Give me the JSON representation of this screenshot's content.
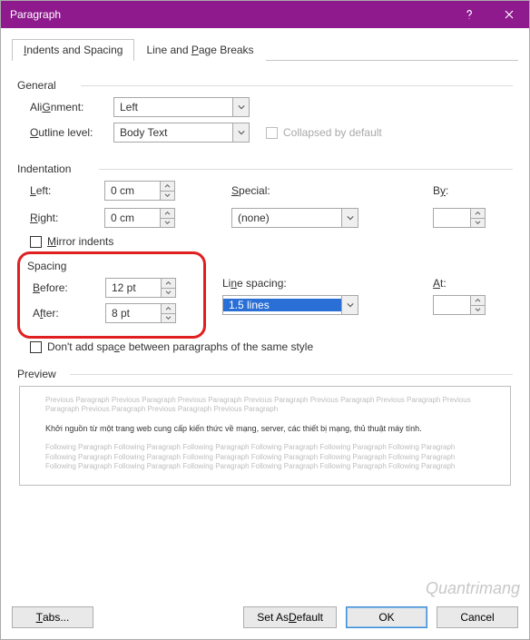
{
  "title": "Paragraph",
  "tabs": {
    "t1": "ndents and Spacing",
    "t2": "ine and ",
    "t2b": "age Breaks"
  },
  "general": {
    "label": "General",
    "alignment_lbl": "Alignment:",
    "alignment_u": "G",
    "alignment_val": "Left",
    "outline_lbl": "utline level:",
    "outline_u": "O",
    "outline_val": "Body Text",
    "collapsed_lbl": "Collapsed by default"
  },
  "indent": {
    "label": "Indentation",
    "left_u": "L",
    "left_lbl": "eft:",
    "left_val": "0 cm",
    "right_u": "R",
    "right_lbl": "ight:",
    "right_val": "0 cm",
    "special_u": "S",
    "special_lbl": "pecial:",
    "special_val": "(none)",
    "by_u": "y",
    "by_lbl": "B",
    "by_val": "",
    "mirror_u": "M",
    "mirror_lbl": "irror indents"
  },
  "spacing": {
    "label": "Spacing",
    "before_u": "B",
    "before_lbl": "efore:",
    "before_val": "12 pt",
    "after_u": "f",
    "after_lbl_a": "A",
    "after_lbl_b": "ter:",
    "after_val": "8 pt",
    "line_u": "N",
    "line_lbl": "Li",
    "line_lbl2": "e spacing:",
    "line_val": "1.5 lines",
    "at_u": "A",
    "at_lbl": "t:",
    "at_val": "",
    "dont_lbl": "Don't add spa",
    "dont_u": "c",
    "dont_lbl2": "e between paragraphs of the same style"
  },
  "preview": {
    "label": "Preview",
    "prev": "Previous Paragraph Previous Paragraph Previous Paragraph Previous Paragraph Previous Paragraph Previous Paragraph Previous Paragraph Previous Paragraph Previous Paragraph Previous Paragraph",
    "sample": "Khởi nguồn từ một trang web cung cấp kiến thức về mạng, server, các thiết bị mạng, thủ thuật máy tính.",
    "foll": "Following Paragraph Following Paragraph Following Paragraph Following Paragraph Following Paragraph Following Paragraph Following Paragraph Following Paragraph Following Paragraph Following Paragraph Following Paragraph Following Paragraph Following Paragraph Following Paragraph Following Paragraph Following Paragraph Following Paragraph Following Paragraph"
  },
  "buttons": {
    "tabs_u": "T",
    "tabs": "abs...",
    "setdef_u": "D",
    "setdef_a": "Set As ",
    "setdef_b": "efault",
    "ok": "OK",
    "cancel": "Cancel"
  },
  "watermark": "Quantrimang"
}
